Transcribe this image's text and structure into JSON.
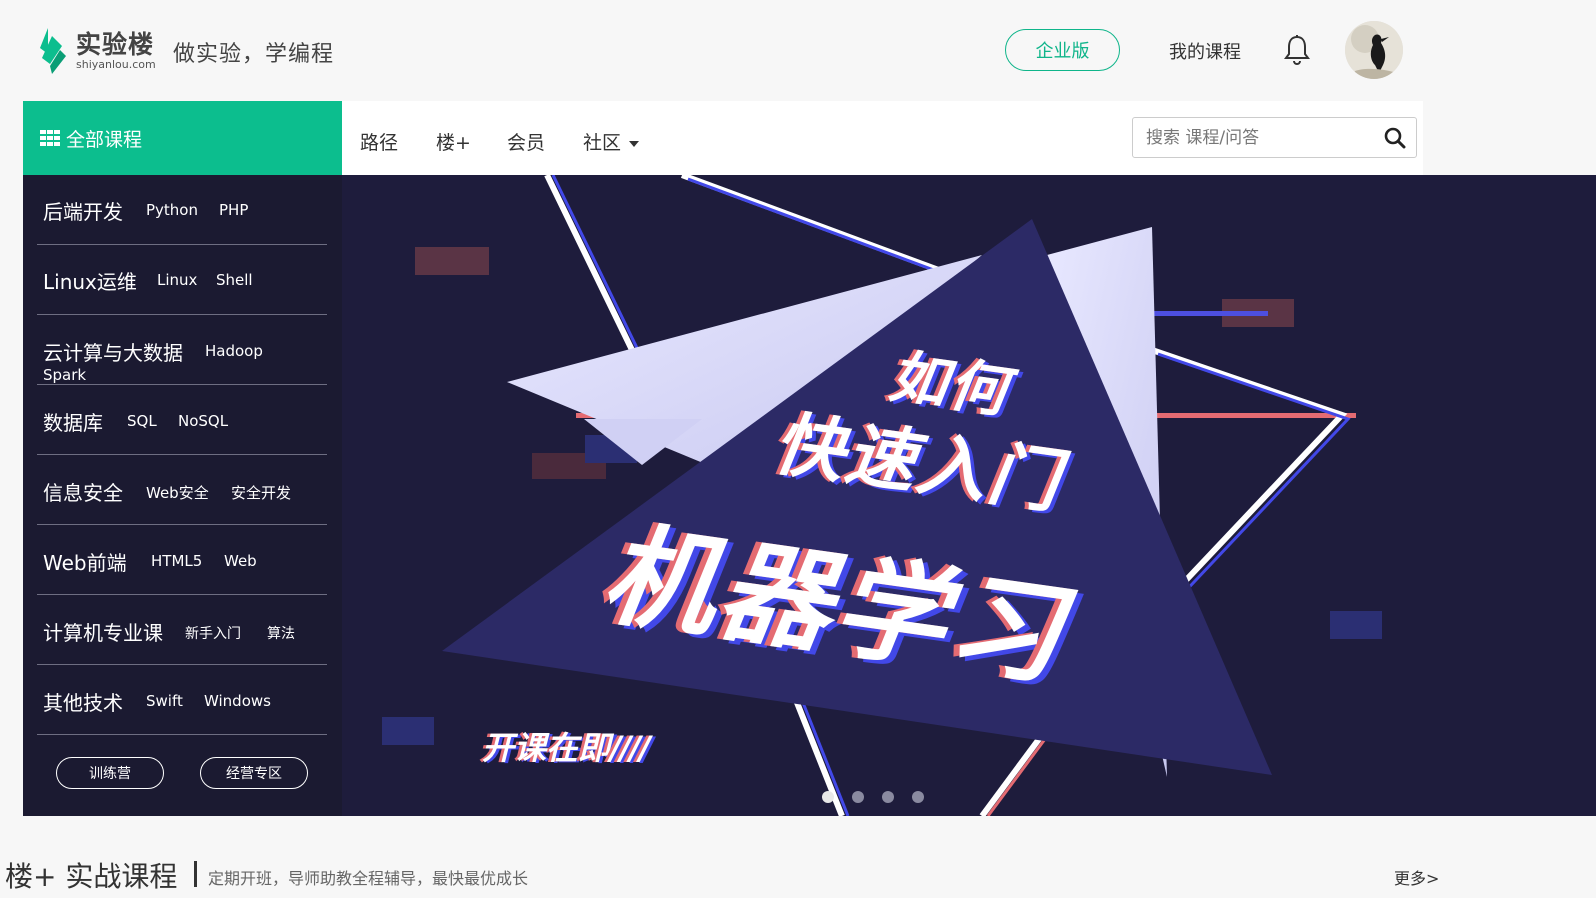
{
  "header": {
    "logo_name": "实验楼",
    "logo_domain": "shiyanlou.com",
    "slogan": "做实验，学编程",
    "enterprise_label": "企业版",
    "my_courses_label": "我的课程",
    "brand_color": "#0cbe8e"
  },
  "nav": {
    "all_courses_label": "全部课程",
    "items": [
      {
        "label": "路径"
      },
      {
        "label": "楼+"
      },
      {
        "label": "会员"
      },
      {
        "label": "社区"
      }
    ],
    "search_placeholder": "搜索 课程/问答"
  },
  "sidebar": {
    "categories": [
      {
        "name": "后端开发",
        "tags": [
          "Python",
          "PHP"
        ]
      },
      {
        "name": "Linux运维",
        "tags": [
          "Linux",
          "Shell"
        ]
      },
      {
        "name": "云计算与大数据",
        "tags": [
          "Hadoop",
          "Spark"
        ]
      },
      {
        "name": "数据库",
        "tags": [
          "SQL",
          "NoSQL"
        ]
      },
      {
        "name": "信息安全",
        "tags": [
          "Web安全",
          "安全开发"
        ]
      },
      {
        "name": "Web前端",
        "tags": [
          "HTML5",
          "Web"
        ]
      },
      {
        "name": "计算机专业课",
        "tags": [
          "新手入门",
          "算法"
        ]
      },
      {
        "name": "其他技术",
        "tags": [
          "Swift",
          "Windows"
        ]
      }
    ],
    "buttons": [
      "训练营",
      "经营专区"
    ]
  },
  "banner": {
    "line1": "如何",
    "line2": "快速入门",
    "line3": "机器学习",
    "tagline": "开课在即",
    "slide_count": 4,
    "active_slide": 0
  },
  "section": {
    "title": "楼+ 实战课程",
    "subtitle": "定期开班，导师助教全程辅导，最快最优成长",
    "more_label": "更多>"
  }
}
